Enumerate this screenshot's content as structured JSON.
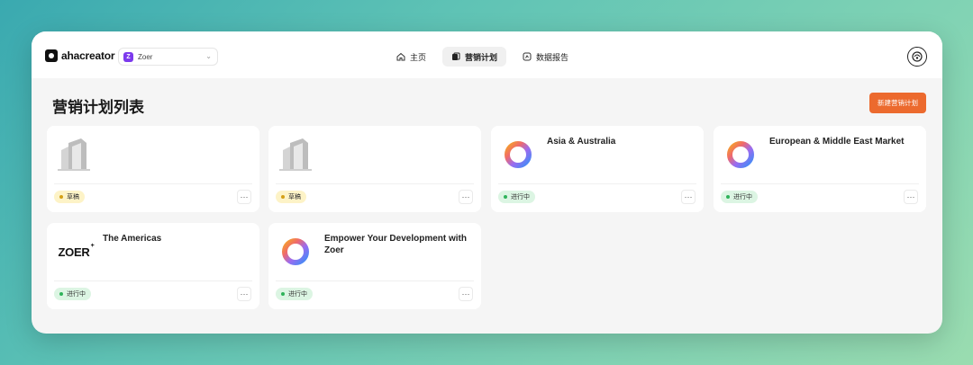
{
  "app": {
    "logo_text": "ahacreator",
    "workspace": {
      "initial": "Z",
      "name": "Zoer"
    }
  },
  "nav": {
    "tabs": [
      {
        "label": "主页",
        "icon": "home-icon",
        "active": false
      },
      {
        "label": "营销计划",
        "icon": "plans-icon",
        "active": true
      },
      {
        "label": "数据报告",
        "icon": "report-icon",
        "active": false
      }
    ]
  },
  "page": {
    "title": "营销计划列表",
    "new_button_label": "新建营销计划"
  },
  "cards": [
    {
      "title": "",
      "thumb": "building-placeholder-icon",
      "status": "草稿",
      "status_type": "draft"
    },
    {
      "title": "",
      "thumb": "building-placeholder-icon",
      "status": "草稿",
      "status_type": "draft"
    },
    {
      "title": "Asia & Australia",
      "thumb": "gradient-ring-logo",
      "status": "进行中",
      "status_type": "active"
    },
    {
      "title": "European & Middle East Market",
      "thumb": "gradient-ring-logo",
      "status": "进行中",
      "status_type": "active"
    },
    {
      "title": "The Americas",
      "thumb": "zoer-logo",
      "thumb_text": "ZOER",
      "thumb_sup": "+",
      "status": "进行中",
      "status_type": "active"
    },
    {
      "title": "Empower Your Development with Zoer",
      "thumb": "gradient-ring-logo",
      "status": "进行中",
      "status_type": "active"
    }
  ],
  "more_label": "···",
  "colors": {
    "accent": "#ec6a2e",
    "draft_bg": "#fdf3c7",
    "active_bg": "#dcf5e3"
  }
}
